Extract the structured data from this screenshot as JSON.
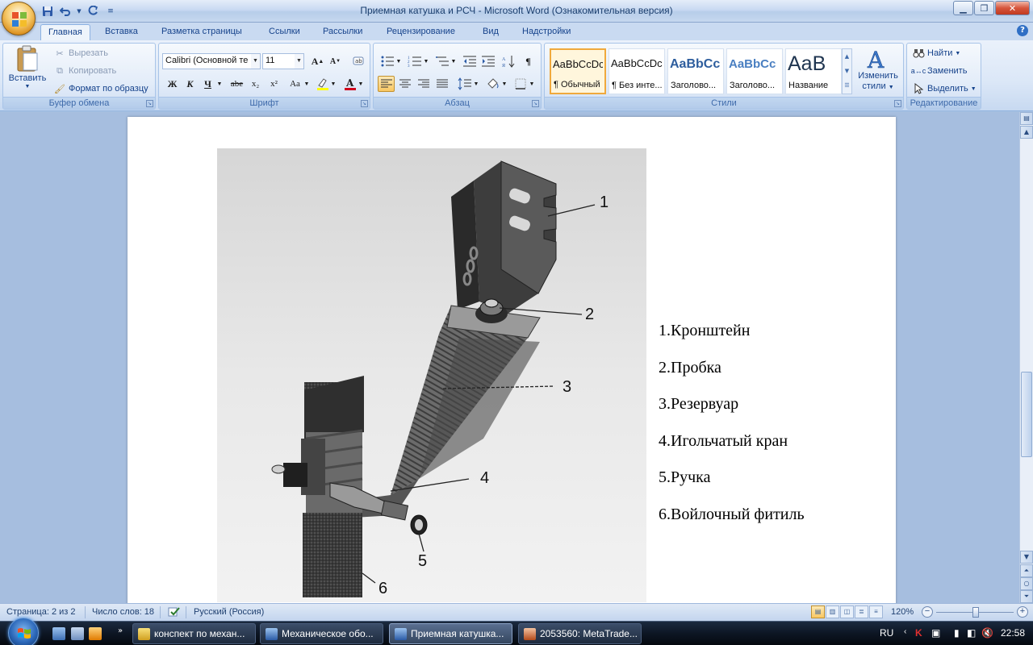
{
  "window": {
    "title": "Приемная катушка и РСЧ - Microsoft Word (Ознакомительная версия)"
  },
  "tabs": [
    "Главная",
    "Вставка",
    "Разметка страницы",
    "Ссылки",
    "Рассылки",
    "Рецензирование",
    "Вид",
    "Надстройки"
  ],
  "ribbon": {
    "clipboard": {
      "label": "Буфер обмена",
      "paste": "Вставить",
      "cut": "Вырезать",
      "copy": "Копировать",
      "format_painter": "Формат по образцу"
    },
    "font": {
      "label": "Шрифт",
      "font_name": "Calibri (Основной те",
      "font_size": "11",
      "bold": "Ж",
      "italic": "К",
      "underline": "Ч",
      "strike": "abe",
      "subscript": "x₂",
      "superscript": "x²",
      "change_case": "Aa"
    },
    "paragraph": {
      "label": "Абзац"
    },
    "styles": {
      "label": "Стили",
      "items": [
        {
          "sample": "AaBbCcDc",
          "name": "¶ Обычный"
        },
        {
          "sample": "AaBbCcDc",
          "name": "¶ Без инте..."
        },
        {
          "sample": "AaBbCc",
          "name": "Заголово..."
        },
        {
          "sample": "AaBbCc",
          "name": "Заголово..."
        },
        {
          "sample": "AaB",
          "name": "Название"
        }
      ],
      "change_styles": [
        "Изменить",
        "стили"
      ]
    },
    "editing": {
      "label": "Редактирование",
      "find": "Найти",
      "replace": "Заменить",
      "select": "Выделить"
    }
  },
  "document": {
    "figure_callouts": [
      "1",
      "2",
      "3",
      "4",
      "5",
      "6"
    ],
    "legend": [
      "1.Кронштейн",
      "2.Пробка",
      "3.Резервуар",
      "4.Игольчатый кран",
      "5.Ручка",
      "6.Войлочный фитиль"
    ]
  },
  "statusbar": {
    "page": "Страница: 2 из 2",
    "words": "Число слов: 18",
    "language": "Русский (Россия)",
    "zoom": "120%",
    "zoom_level": 1.2
  },
  "taskbar": {
    "tasks": [
      {
        "label": "конспект по механ...",
        "active": false
      },
      {
        "label": "Механическое обо...",
        "active": false
      },
      {
        "label": "Приемная катушка...",
        "active": true
      },
      {
        "label": "2053560: MetaTrade...",
        "active": false
      }
    ],
    "lang": "RU",
    "clock": "22:58"
  },
  "colors": {
    "ribbon_text": "#15428b",
    "selected_style": "#f0a93c",
    "taskbar": "#0d1624"
  }
}
